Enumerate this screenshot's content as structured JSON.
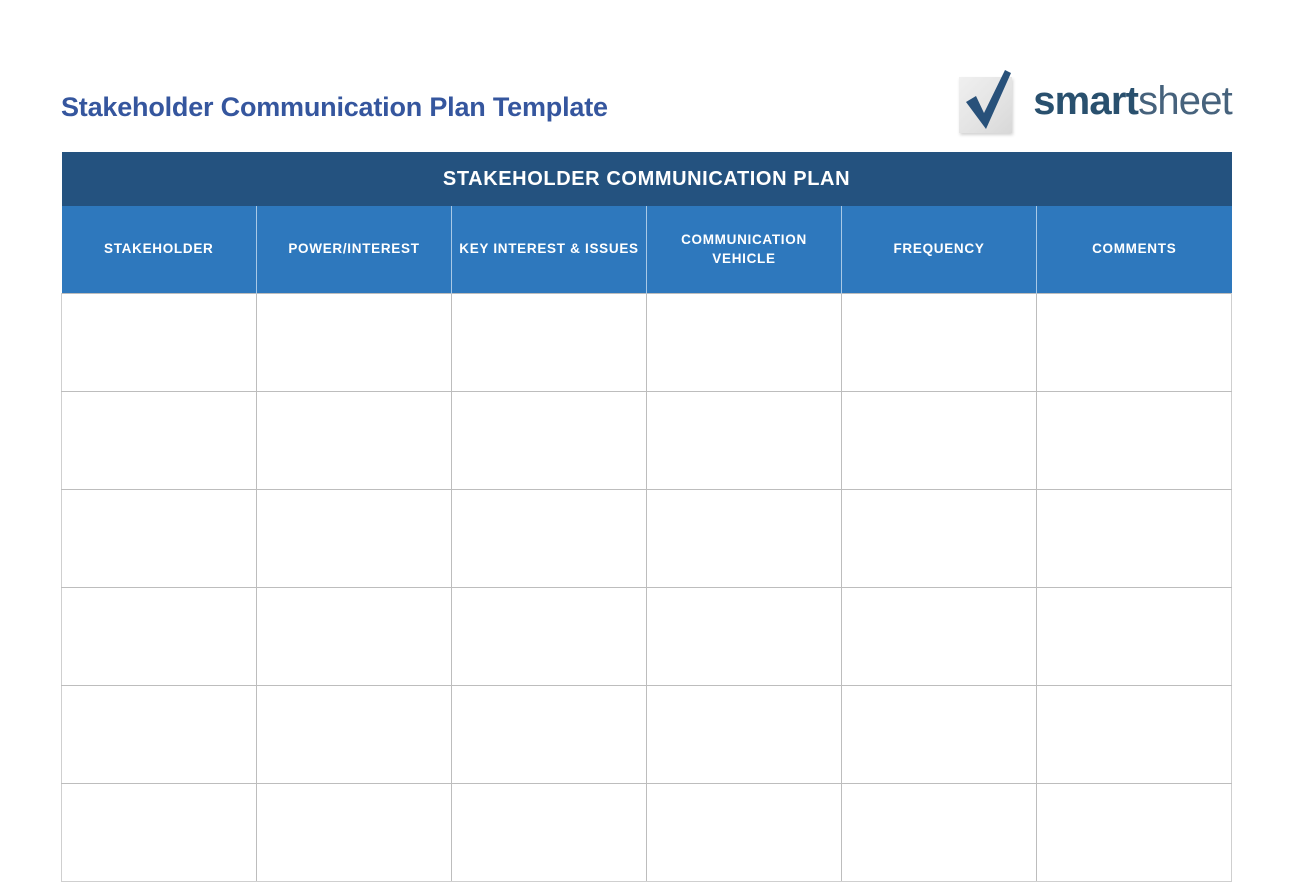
{
  "document": {
    "title": "Stakeholder Communication Plan Template"
  },
  "logo": {
    "mark_icon": "checkmark-icon",
    "word_first": "smart",
    "word_second": "sheet"
  },
  "table": {
    "banner_title": "STAKEHOLDER COMMUNICATION PLAN",
    "columns": [
      "STAKEHOLDER",
      "POWER/INTEREST",
      "KEY INTEREST & ISSUES",
      "COMMUNICATION VEHICLE",
      "FREQUENCY",
      "COMMENTS"
    ],
    "rows": [
      [
        "",
        "",
        "",
        "",
        "",
        ""
      ],
      [
        "",
        "",
        "",
        "",
        "",
        ""
      ],
      [
        "",
        "",
        "",
        "",
        "",
        ""
      ],
      [
        "",
        "",
        "",
        "",
        "",
        ""
      ],
      [
        "",
        "",
        "",
        "",
        "",
        ""
      ],
      [
        "",
        "",
        "",
        "",
        "",
        ""
      ]
    ]
  },
  "colors": {
    "title_text": "#35569e",
    "banner_bg": "#24527f",
    "header_bg": "#2e78bd",
    "grid_line": "#bdbdbd",
    "page_bg": "#ffffff"
  }
}
